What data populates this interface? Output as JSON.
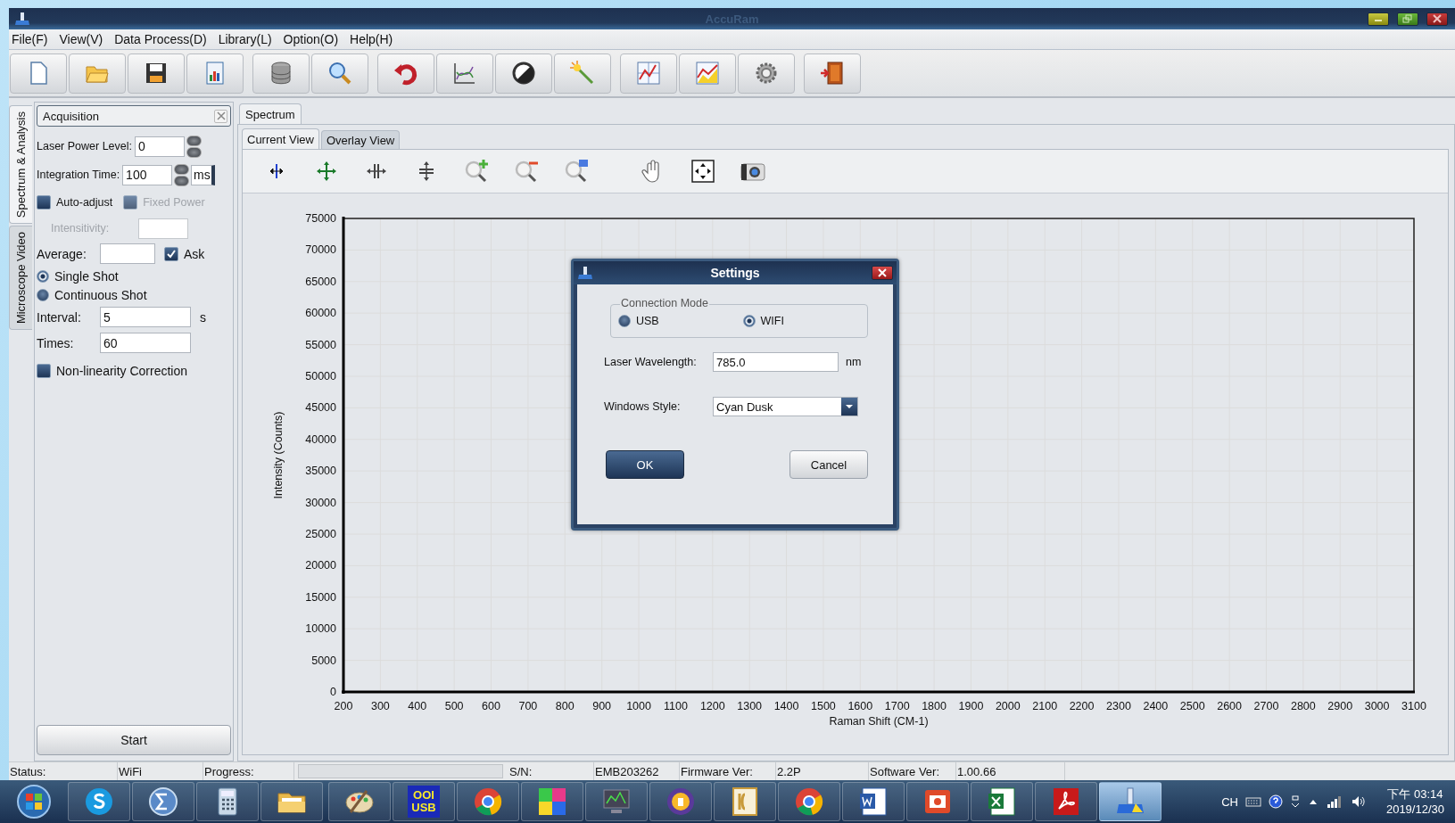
{
  "window": {
    "title": "AccuRam"
  },
  "menu": [
    "File(F)",
    "View(V)",
    "Data Process(D)",
    "Library(L)",
    "Option(O)",
    "Help(H)"
  ],
  "side_tabs": [
    {
      "label": "Spectrum & Analysis",
      "selected": true
    },
    {
      "label": "Microscope Video",
      "selected": false
    }
  ],
  "acquisition": {
    "title": "Acquisition",
    "laser_power": {
      "label": "Laser Power Level:",
      "value": "0"
    },
    "integration": {
      "label": "Integration Time:",
      "value": "100",
      "unit": "ms"
    },
    "auto_adjust": {
      "label": "Auto-adjust",
      "checked": false
    },
    "fixed_power": {
      "label": "Fixed Power",
      "checked": false,
      "disabled": true
    },
    "intensitivity": {
      "label": "Intensitivity:",
      "disabled": true
    },
    "average": {
      "label": "Average:"
    },
    "ask": {
      "label": "Ask",
      "checked": true
    },
    "shot_modes": [
      {
        "label": "Single Shot",
        "selected": true
      },
      {
        "label": "Continuous Shot",
        "selected": false
      }
    ],
    "interval": {
      "label": "Interval:",
      "value": "5",
      "unit": "s"
    },
    "times": {
      "label": "Times:",
      "value": "60"
    },
    "nonlinearity": {
      "label": "Non-linearity Correction",
      "checked": false
    },
    "start_button": "Start"
  },
  "spectrum": {
    "tab": "Spectrum",
    "views": [
      {
        "label": "Current View",
        "selected": true
      },
      {
        "label": "Overlay View",
        "selected": false
      }
    ],
    "chart_data": {
      "type": "line",
      "grid": true,
      "xlabel": "Raman Shift (CM-1)",
      "ylabel": "Intensity (Counts)",
      "xlim": [
        200,
        3100
      ],
      "ylim": [
        0,
        75000
      ],
      "xticks": [
        200,
        300,
        400,
        500,
        600,
        700,
        800,
        900,
        1000,
        1100,
        1200,
        1300,
        1400,
        1500,
        1600,
        1700,
        1800,
        1900,
        2000,
        2100,
        2200,
        2300,
        2400,
        2500,
        2600,
        2700,
        2800,
        2900,
        3000,
        3100
      ],
      "yticks": [
        0,
        5000,
        10000,
        15000,
        20000,
        25000,
        30000,
        35000,
        40000,
        45000,
        50000,
        55000,
        60000,
        65000,
        70000,
        75000
      ]
    }
  },
  "settings_dialog": {
    "title": "Settings",
    "group_title": "Connection Mode",
    "modes": [
      {
        "label": "USB",
        "selected": false
      },
      {
        "label": "WIFI",
        "selected": true
      }
    ],
    "wavelength": {
      "label": "Laser Wavelength:",
      "value": "785.0",
      "unit": "nm"
    },
    "style": {
      "label": "Windows Style:",
      "value": "Cyan Dusk"
    },
    "ok_button": "OK",
    "cancel_button": "Cancel"
  },
  "status_bar": {
    "status_label": "Status:",
    "status": "WiFi",
    "progress_label": "Progress:",
    "progress": {
      "level": 0
    },
    "sn_label": "S/N:",
    "sn": "EMB203262",
    "firmware_label": "Firmware Ver:",
    "firmware": "2.2P",
    "software_label": "Software Ver:",
    "software": "1.00.66"
  },
  "taskbar": {
    "badge_text": [
      "OOI",
      "USB"
    ],
    "language": "CH",
    "time": "下午 03:14",
    "date": "2019/12/30"
  }
}
